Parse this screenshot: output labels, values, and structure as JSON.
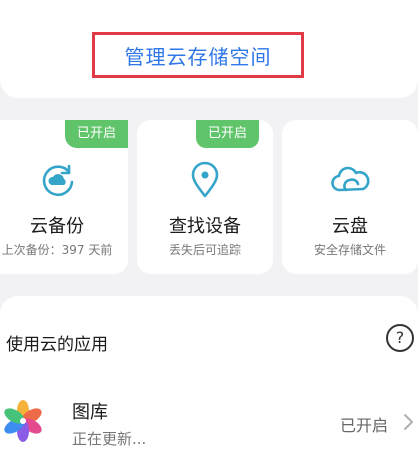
{
  "header": {
    "manage_label": "管理云存储空间"
  },
  "cards": [
    {
      "badge": "已开启",
      "title": "云备份",
      "subtitle": "上次备份：397 天前",
      "icon": "cloud-backup-icon"
    },
    {
      "badge": "已开启",
      "title": "查找设备",
      "subtitle": "丢失后可追踪",
      "icon": "location-pin-icon"
    },
    {
      "title": "云盘",
      "subtitle": "安全存储文件",
      "icon": "cloud-drive-icon"
    }
  ],
  "apps": {
    "section_title": "使用云的应用",
    "help": "?",
    "items": [
      {
        "name": "图库",
        "status": "正在更新...",
        "state": "已开启",
        "icon": "gallery-pinwheel-icon"
      }
    ]
  },
  "colors": {
    "accent": "#2f77e8",
    "highlight_border": "#e23a44",
    "badge": "#5fc46a",
    "icon": "#35a4c9"
  }
}
